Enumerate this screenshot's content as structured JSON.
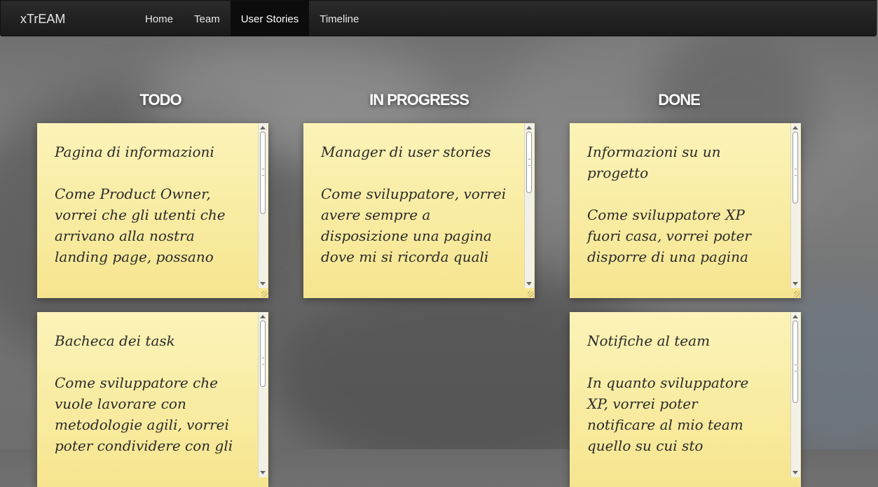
{
  "app": {
    "brand": "xTrEAM"
  },
  "nav": {
    "items": [
      {
        "label": "Home"
      },
      {
        "label": "Team"
      },
      {
        "label": "User Stories"
      },
      {
        "label": "Timeline"
      }
    ]
  },
  "columns": [
    {
      "title": "TODO",
      "cards": [
        {
          "text": "Pagina di informazioni\n\nCome Product Owner,\nvorrei che gli utenti che\narrivano alla nostra\nlanding page, possano"
        },
        {
          "text": "Bacheca dei task\n\nCome sviluppatore che\nvuole lavorare con\nmetodologie agili, vorrei\npoter condividere con gli"
        }
      ]
    },
    {
      "title": "IN PROGRESS",
      "cards": [
        {
          "text": "Manager di user stories\n\nCome sviluppatore, vorrei\navere sempre a\ndisposizione una pagina\ndove mi si ricorda quali"
        }
      ]
    },
    {
      "title": "DONE",
      "cards": [
        {
          "text": "Informazioni su un\nprogetto\n\nCome sviluppatore XP\nfuori casa, vorrei poter\ndisporre di una pagina"
        },
        {
          "text": "Notifiche al team\n\nIn quanto sviluppatore\nXP, vorrei poter\nnotificare al mio team\nquello su cui sto"
        }
      ]
    }
  ]
}
